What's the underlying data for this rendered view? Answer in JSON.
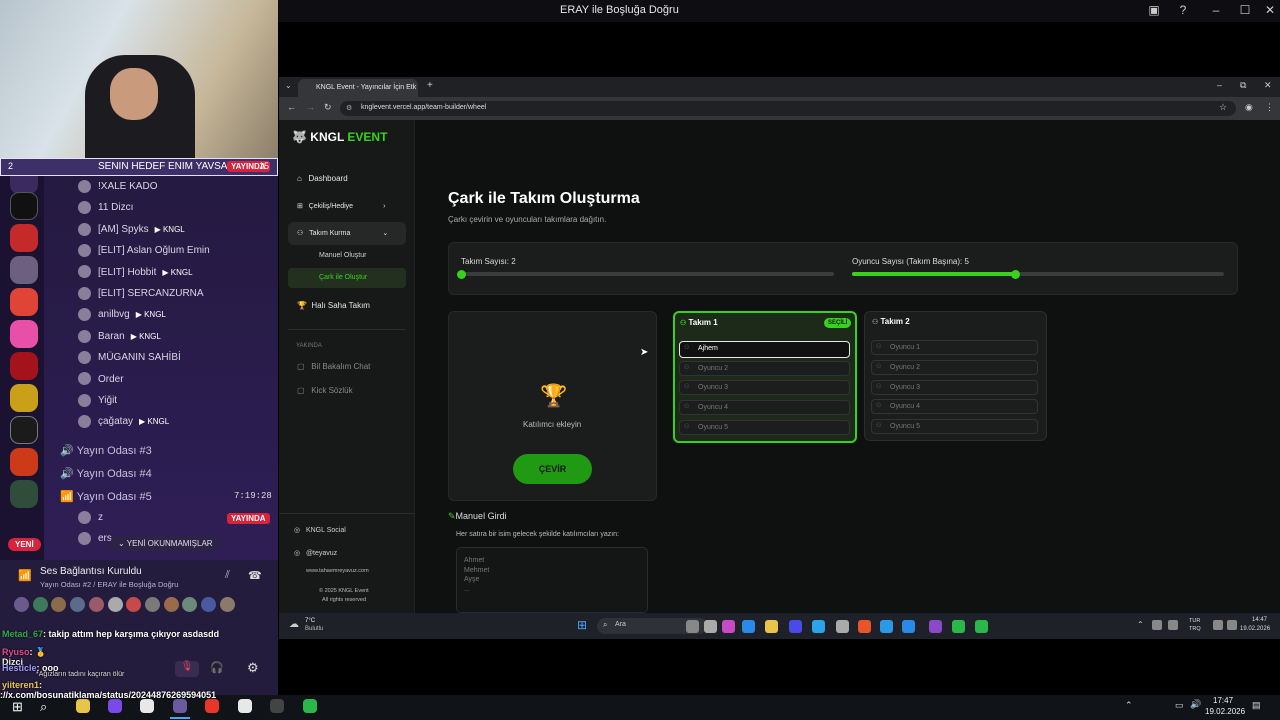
{
  "host": {
    "title": "ERAY ile Boşluğa Doğru"
  },
  "discord": {
    "top_user": "SENIN HEDEF ENIM YAVSAK...",
    "top_live": "YAYINDA",
    "top_count": "15",
    "top_left": "2",
    "users": [
      {
        "name": "!XALE KADO",
        "badge": ""
      },
      {
        "name": "11 Dizcı",
        "badge": ""
      },
      {
        "name": "[AM] Spyks",
        "badge": "KNGL"
      },
      {
        "name": "[ELIT] Aslan Oğlum Emin",
        "badge": ""
      },
      {
        "name": "[ELIT] Hobbit",
        "badge": "KNGL"
      },
      {
        "name": "[ELIT] SERCANZURNA",
        "badge": ""
      },
      {
        "name": "anilbvg",
        "badge": "KNGL"
      },
      {
        "name": "Baran",
        "badge": "KNGL"
      },
      {
        "name": "MÜGANIN SAHİBİ",
        "badge": ""
      },
      {
        "name": "Order",
        "badge": ""
      },
      {
        "name": "Yiğit",
        "badge": ""
      },
      {
        "name": "çağatay",
        "badge": "KNGL"
      }
    ],
    "channels": [
      "Yayın Odası #3",
      "Yayın Odası #4",
      "Yayın Odası #5"
    ],
    "channel5_time": "7:19:28",
    "z_user": "z",
    "z_live": "YAYINDA",
    "ers_user": "ers",
    "new_unread": "YENİ OKUNMAMIŞLAR",
    "yeni": "YENİ",
    "voice_status": "Ses Bağlantısı Kuruldu",
    "voice_channel": "Yayın Odası #2 / ERAY ile Boşluğa Doğru"
  },
  "chat": [
    {
      "user": "Metad_67",
      "text": ": takip attım hep karşıma çıkıyor asdasdd"
    },
    {
      "user": "Ryuso",
      "text": ": 🥇"
    },
    {
      "user": "Dizci",
      "text": ""
    },
    {
      "user": "Hesticle",
      "text": ": ooo"
    },
    {
      "user": "",
      "text": "*Ağızların tadını kaçıran ölür"
    },
    {
      "user": "yiiteren1",
      "text": ":"
    }
  ],
  "browser": {
    "tab_title": "KNGL Event - Yayıncılar İçin Etk",
    "url": "knglevent.vercel.app/team-builder/wheel"
  },
  "app": {
    "logo_main": "KNGL",
    "logo_accent": "EVENT",
    "nav": {
      "dashboard": "Dashboard",
      "cekilis": "Çekiliş/Hediye",
      "takim": "Takım Kurma",
      "manuel": "Manuel Oluştur",
      "cark": "Çark ile Oluştur",
      "hali": "Halı Saha Takım",
      "yakinda": "YAKINDA",
      "bil": "Bil Bakalım Chat",
      "kick": "Kick Sözlük"
    },
    "footer": {
      "social": "KNGL Social",
      "handle": "@teyavuz",
      "site": "www.tahaemreyavuz.com",
      "copy1": "© 2025 KNGL Event",
      "copy2": "All rights reserved"
    },
    "title": "Çark ile Takım Oluşturma",
    "subtitle": "Çarkı çevirin ve oyuncuları takımlara dağıtın.",
    "team_count_label": "Takım Sayısı: 2",
    "player_count_label": "Oyuncu Sayısı (Takım Başına): 5",
    "team_count_fraction": 0.0,
    "player_count_fraction": 0.44,
    "add_participant": "Katılımcı ekleyin",
    "spin": "ÇEVİR",
    "team1": {
      "name": "Takım 1",
      "badge": "SEÇİLİ",
      "slots": [
        "Ajhem",
        "Oyuncu 2",
        "Oyuncu 3",
        "Oyuncu 4",
        "Oyuncu 5"
      ]
    },
    "team2": {
      "name": "Takım 2",
      "slots": [
        "Oyuncu 1",
        "Oyuncu 2",
        "Oyuncu 3",
        "Oyuncu 4",
        "Oyuncu 5"
      ]
    },
    "manual_title": "Manuel Girdi",
    "manual_hint": "Her satıra bir isim gelecek şekilde katılımcıları yazın:",
    "manual_placeholder": "Ahmet\nMehmet\nAyşe\n..."
  },
  "inner_taskbar": {
    "weather_temp": "7°C",
    "weather_desc": "Bulutlu",
    "search": "Ara",
    "lang1": "TUR",
    "lang2": "TRQ",
    "time": "14:47",
    "date": "19.02.2026"
  },
  "outer_taskbar": {
    "time": "17:47",
    "date": "19.02.2026",
    "url_overlay": "://x.com/bosunatiklama/status/2024487626959405​1"
  }
}
